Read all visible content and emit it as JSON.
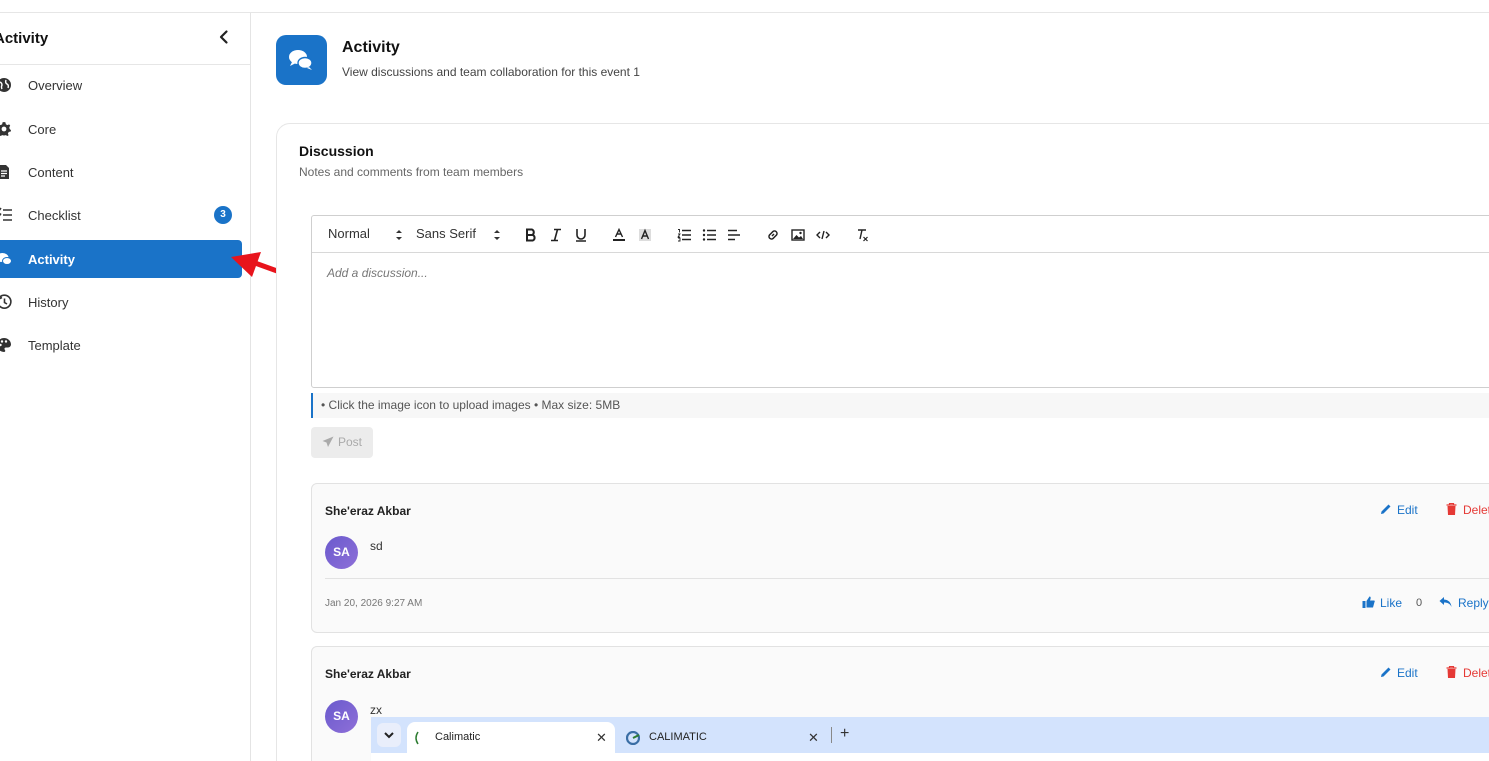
{
  "sidebar": {
    "title": "Activity",
    "items": [
      {
        "label": "Overview",
        "icon": "globe-icon"
      },
      {
        "label": "Core",
        "icon": "gear-icon"
      },
      {
        "label": "Content",
        "icon": "document-icon"
      },
      {
        "label": "Checklist",
        "icon": "checklist-icon",
        "badge": "3"
      },
      {
        "label": "Activity",
        "icon": "comments-icon",
        "active": true
      },
      {
        "label": "History",
        "icon": "history-icon"
      },
      {
        "label": "Template",
        "icon": "palette-icon"
      }
    ]
  },
  "header": {
    "title": "Activity",
    "subtitle": "View discussions and team collaboration for this event 1"
  },
  "discussion": {
    "title": "Discussion",
    "subtitle": "Notes and comments from team members",
    "toolbar": {
      "heading_select": "Normal",
      "font_select": "Sans Serif"
    },
    "editor_placeholder": "Add a discussion...",
    "hint": "• Click the image icon to upload images • Max size: 5MB",
    "post_label": "Post"
  },
  "comments": [
    {
      "author": "She'eraz Akbar",
      "initials": "SA",
      "body": "sd",
      "date": "Jan 20, 2026 9:27 AM",
      "edit_label": "Edit",
      "delete_label": "Delet",
      "like_label": "Like",
      "like_count": "0",
      "reply_label": "Reply"
    },
    {
      "author": "She'eraz Akbar",
      "initials": "SA",
      "body": "zx",
      "edit_label": "Edit",
      "delete_label": "Delet"
    }
  ],
  "browser_tabs": [
    {
      "label": "Calimatic",
      "active": true
    },
    {
      "label": "CALIMATIC",
      "active": false
    }
  ],
  "colors": {
    "accent": "#1a73c8",
    "danger": "#e53935",
    "annotation_arrow": "#e8141c"
  }
}
